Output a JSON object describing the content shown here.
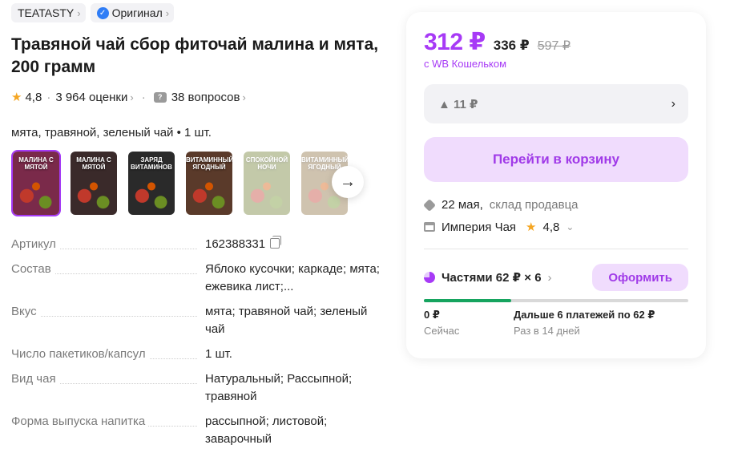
{
  "badges": {
    "brand": "TEATASTY",
    "original": "Оригинал"
  },
  "product": {
    "title_line1": "Травяной чай сбор фиточай малина и мята,",
    "title_line2": "200 грамм",
    "rating": "4,8",
    "reviews": "3 964 оценки",
    "questions": "38 вопросов",
    "variant": "мята, травяной, зеленый чай • 1 шт."
  },
  "thumbnails": [
    {
      "label": "Малина с мятой",
      "color": "#7a2a4a"
    },
    {
      "label": "Малина с мятой",
      "color": "#3a2a2a"
    },
    {
      "label": "Заряд витаминов",
      "color": "#2a2a2a"
    },
    {
      "label": "Витаминный ягодный",
      "color": "#5a3a2a"
    },
    {
      "label": "Спокойной ночи",
      "color": "#6a7a2a"
    },
    {
      "label": "Витаминный ягодный",
      "color": "#8a6a3a"
    }
  ],
  "specs": [
    {
      "key": "Артикул",
      "value": "162388331",
      "copy": true
    },
    {
      "key": "Состав",
      "value": "Яблоко кусочки; каркаде; мята; ежевика лист;..."
    },
    {
      "key": "Вкус",
      "value": "мята; травяной чай; зеленый чай"
    },
    {
      "key": "Число пакетиков/капсул",
      "value": "1 шт."
    },
    {
      "key": "Вид чая",
      "value": "Натуральный; Рассыпной; травяной"
    },
    {
      "key": "Форма выпуска напитка",
      "value": "рассыпной; листовой; заварочный"
    }
  ],
  "card": {
    "price": "312 ₽",
    "price_old": "336 ₽",
    "price_strike": "597 ₽",
    "wallet_note": "с WB Кошельком",
    "price_history": "▲ 11 ₽",
    "cart_button": "Перейти в корзину",
    "delivery_date": "22 мая,",
    "delivery_sub": "склад продавца",
    "shop_name": "Империя Чая",
    "shop_rating": "4,8",
    "parts_label": "Частями 62 ₽ × 6",
    "order_button": "Оформить",
    "progress_fraction": 0.33,
    "now_amount": "0 ₽",
    "now_label": "Сейчас",
    "later_amount": "Дальше 6 платежей по 62 ₽",
    "later_label": "Раз в 14 дней"
  },
  "colors": {
    "accent": "#a73af6",
    "accent_bg": "#f0dcfd",
    "progress": "#16a45f"
  }
}
